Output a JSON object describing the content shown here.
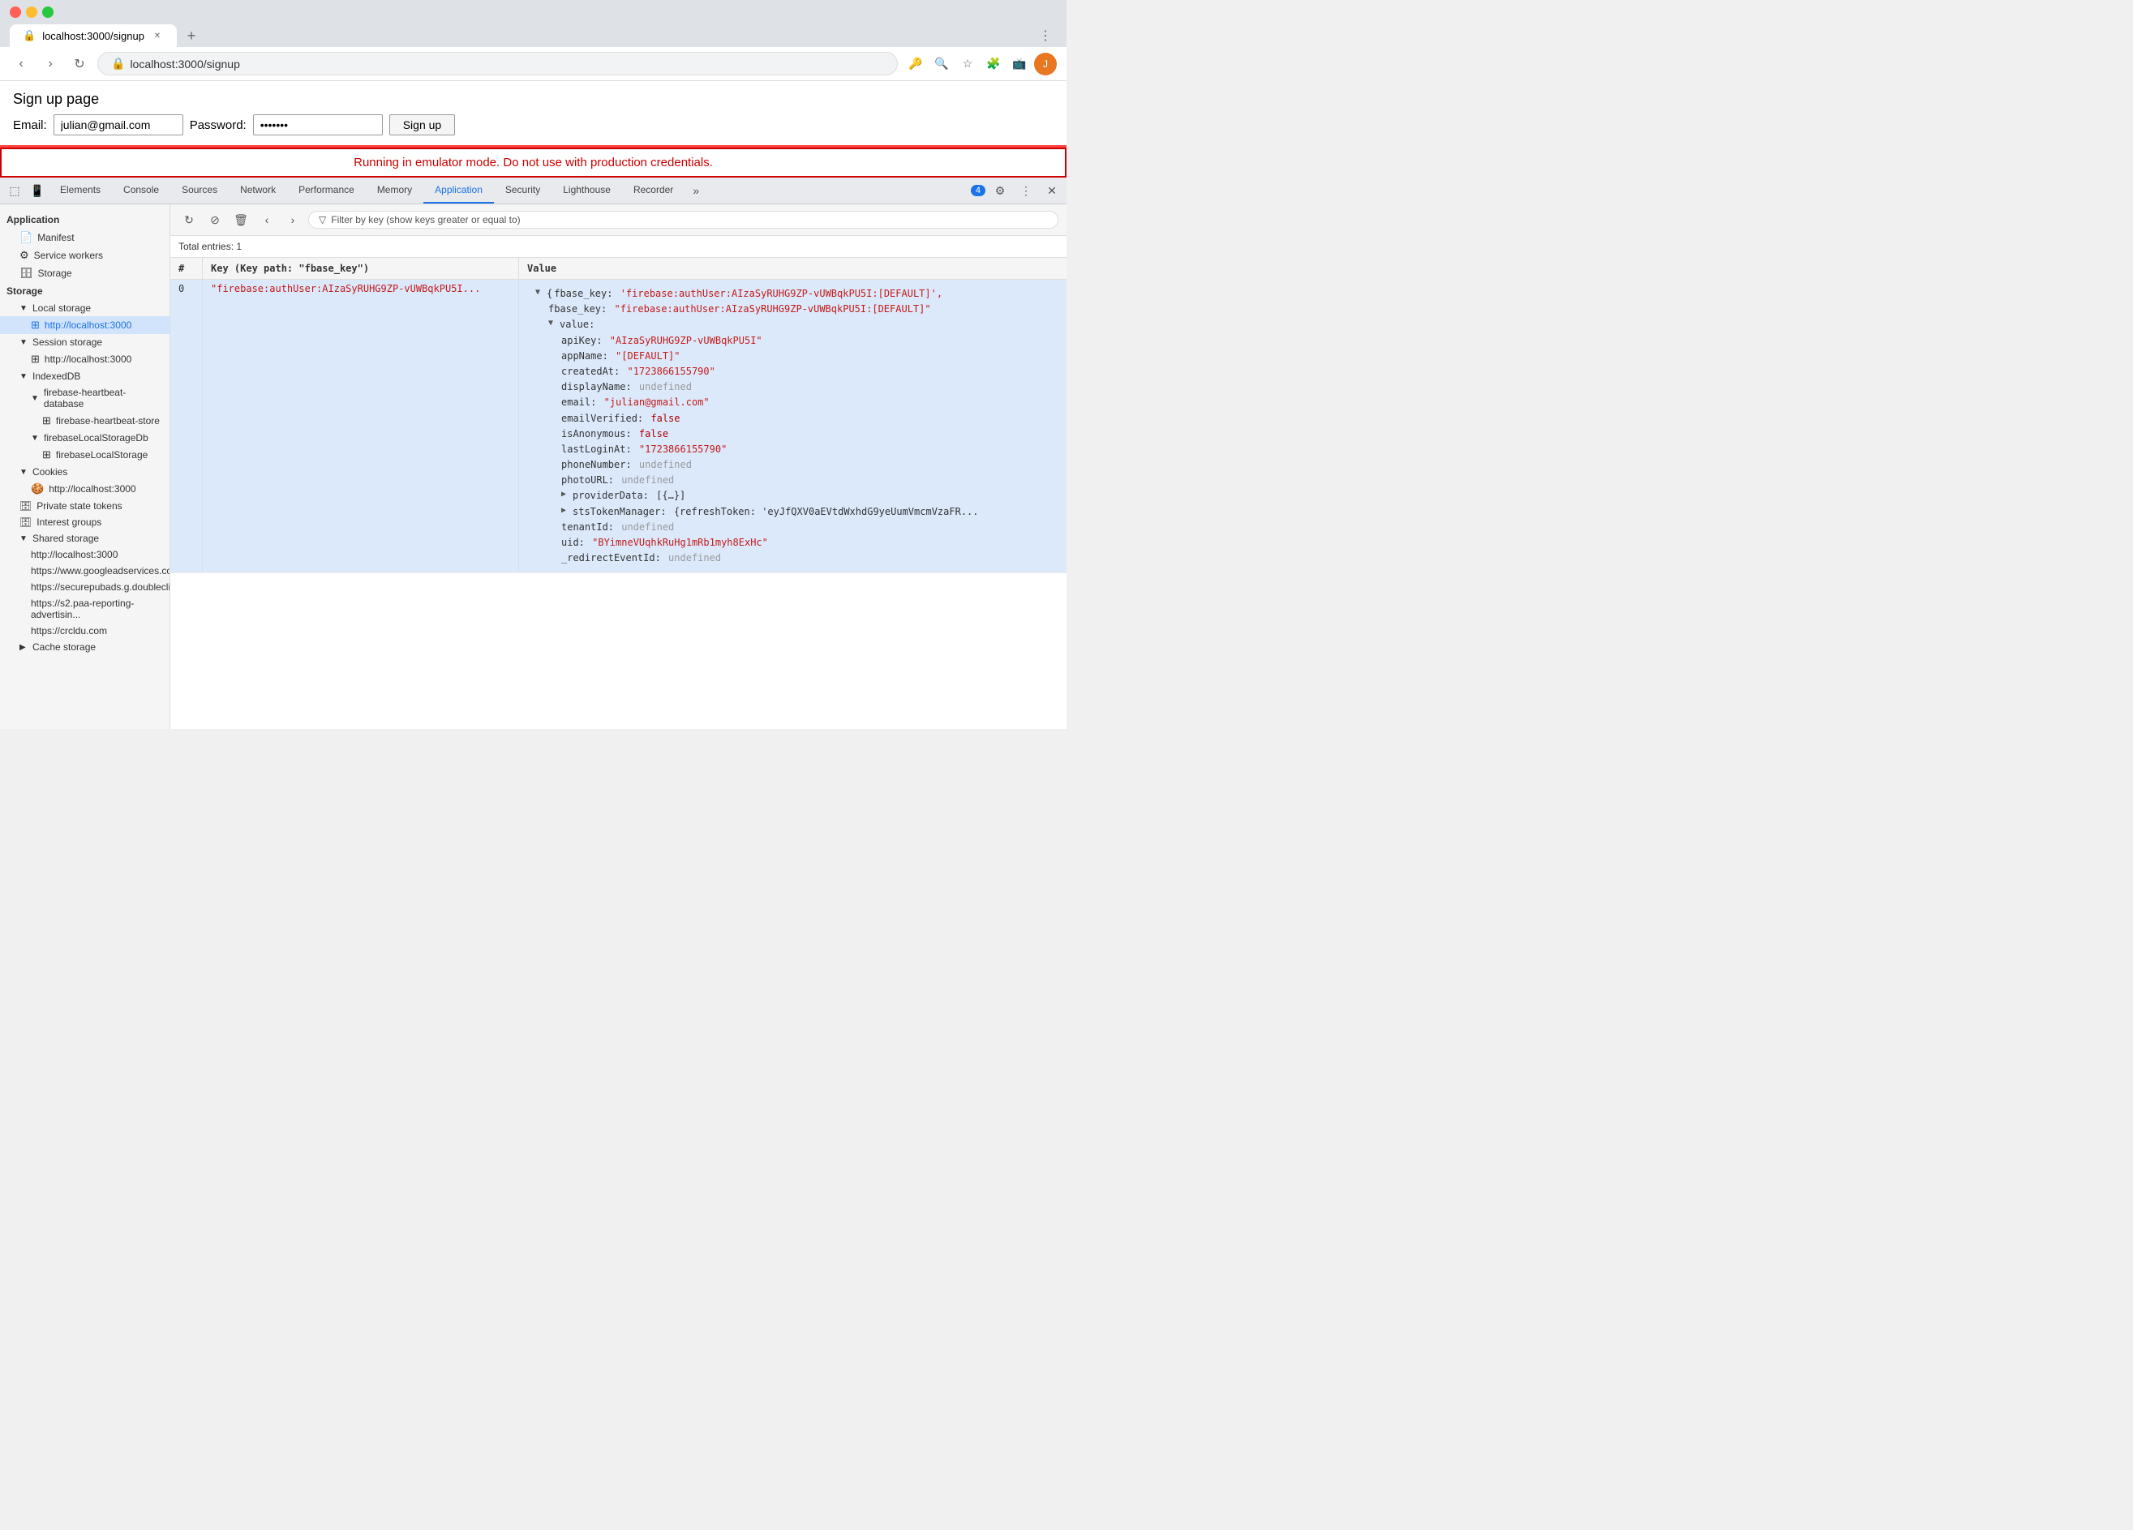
{
  "browser": {
    "url": "localhost:3000/signup",
    "tab_title": "localhost:3000/signup"
  },
  "page": {
    "title": "Sign up page",
    "email_label": "Email:",
    "email_value": "julian@gmail.com",
    "password_label": "Password:",
    "password_value": "•••••••",
    "signup_btn": "Sign up",
    "emulator_warning": "Running in emulator mode. Do not use with production credentials."
  },
  "devtools": {
    "tabs": [
      "Elements",
      "Console",
      "Sources",
      "Network",
      "Performance",
      "Memory",
      "Application",
      "Security",
      "Lighthouse",
      "Recorder"
    ],
    "active_tab": "Application",
    "badge_count": "4"
  },
  "sidebar": {
    "top_header": "Application",
    "items": [
      {
        "label": "Manifest",
        "level": 1,
        "icon": "📄"
      },
      {
        "label": "Service workers",
        "level": 1,
        "icon": "⚙"
      },
      {
        "label": "Storage",
        "level": 1,
        "icon": "🗄"
      }
    ],
    "storage_header": "Storage",
    "storage_items": [
      {
        "label": "Local storage",
        "level": 1,
        "expanded": true
      },
      {
        "label": "http://localhost:3000",
        "level": 2,
        "selected": true
      },
      {
        "label": "Session storage",
        "level": 1,
        "expanded": true
      },
      {
        "label": "http://localhost:3000",
        "level": 2
      },
      {
        "label": "IndexedDB",
        "level": 1,
        "expanded": true
      },
      {
        "label": "firebase-heartbeat-database",
        "level": 2,
        "expanded": true
      },
      {
        "label": "firebase-heartbeat-store",
        "level": 3
      },
      {
        "label": "firebaseLocalStorageDb",
        "level": 2,
        "expanded": true
      },
      {
        "label": "firebaseLocalStorage",
        "level": 3
      },
      {
        "label": "Cookies",
        "level": 1,
        "expanded": true
      },
      {
        "label": "http://localhost:3000",
        "level": 2
      },
      {
        "label": "Private state tokens",
        "level": 1
      },
      {
        "label": "Interest groups",
        "level": 1
      },
      {
        "label": "Shared storage",
        "level": 1,
        "expanded": true
      },
      {
        "label": "http://localhost:3000",
        "level": 2
      },
      {
        "label": "https://www.googleadservices.com",
        "level": 2
      },
      {
        "label": "https://securepubads.g.doublecli...",
        "level": 2
      },
      {
        "label": "https://s2.paa-reporting-advertisin...",
        "level": 2
      },
      {
        "label": "https://crcldu.com",
        "level": 2
      },
      {
        "label": "Cache storage",
        "level": 1
      }
    ]
  },
  "storage_panel": {
    "total_entries": "Total entries: 1",
    "filter_placeholder": "Filter by key (show keys greater or equal to)",
    "col_hash": "#",
    "col_key": "Key (Key path: \"fbase_key\")",
    "col_value": "Value",
    "row_index": "0",
    "row_key": "\"firebase:authUser:AIzaSyRUHG9ZP-vUWBqkPU5I...",
    "value_tree": {
      "root_key": "{fbase_key:",
      "root_val": "'firebase:authUser:AIzaSyRUHG9ZP-vUWBqkPU5I:[DEFAULT]',",
      "fbase_key": "\"firebase:authUser:AIzaSyRUHG9ZP-vUWBqkPU5I:[DEFAULT]\"",
      "value_header": "value:",
      "apiKey_key": "apiKey:",
      "apiKey_val": "\"AIzaSyRUHG9ZP-vUWBqkPU5I\"",
      "appName_key": "appName:",
      "appName_val": "\"[DEFAULT]\"",
      "createdAt_key": "createdAt:",
      "createdAt_val": "\"1723866155790\"",
      "displayName_key": "displayName:",
      "displayName_val": "undefined",
      "email_key": "email:",
      "email_val": "\"julian@gmail.com\"",
      "emailVerified_key": "emailVerified:",
      "emailVerified_val": "false",
      "isAnonymous_key": "isAnonymous:",
      "isAnonymous_val": "false",
      "lastLoginAt_key": "lastLoginAt:",
      "lastLoginAt_val": "\"1723866155790\"",
      "phoneNumber_key": "phoneNumber:",
      "phoneNumber_val": "undefined",
      "photoURL_key": "photoURL:",
      "photoURL_val": "undefined",
      "providerData_key": "providerData:",
      "providerData_val": "[{…}]",
      "stsTokenManager_key": "stsTokenManager:",
      "stsTokenManager_val": "{refreshToken: 'eyJfQXV0aEVtdWxhdG9yeUumVmcmVzaFR...",
      "tenantId_key": "tenantId:",
      "tenantId_val": "undefined",
      "uid_key": "uid:",
      "uid_val": "\"BYimneVUqhkRuHg1mRb1myh8ExHc\"",
      "redirectEventId_key": "_redirectEventId:",
      "redirectEventId_val": "undefined"
    }
  }
}
